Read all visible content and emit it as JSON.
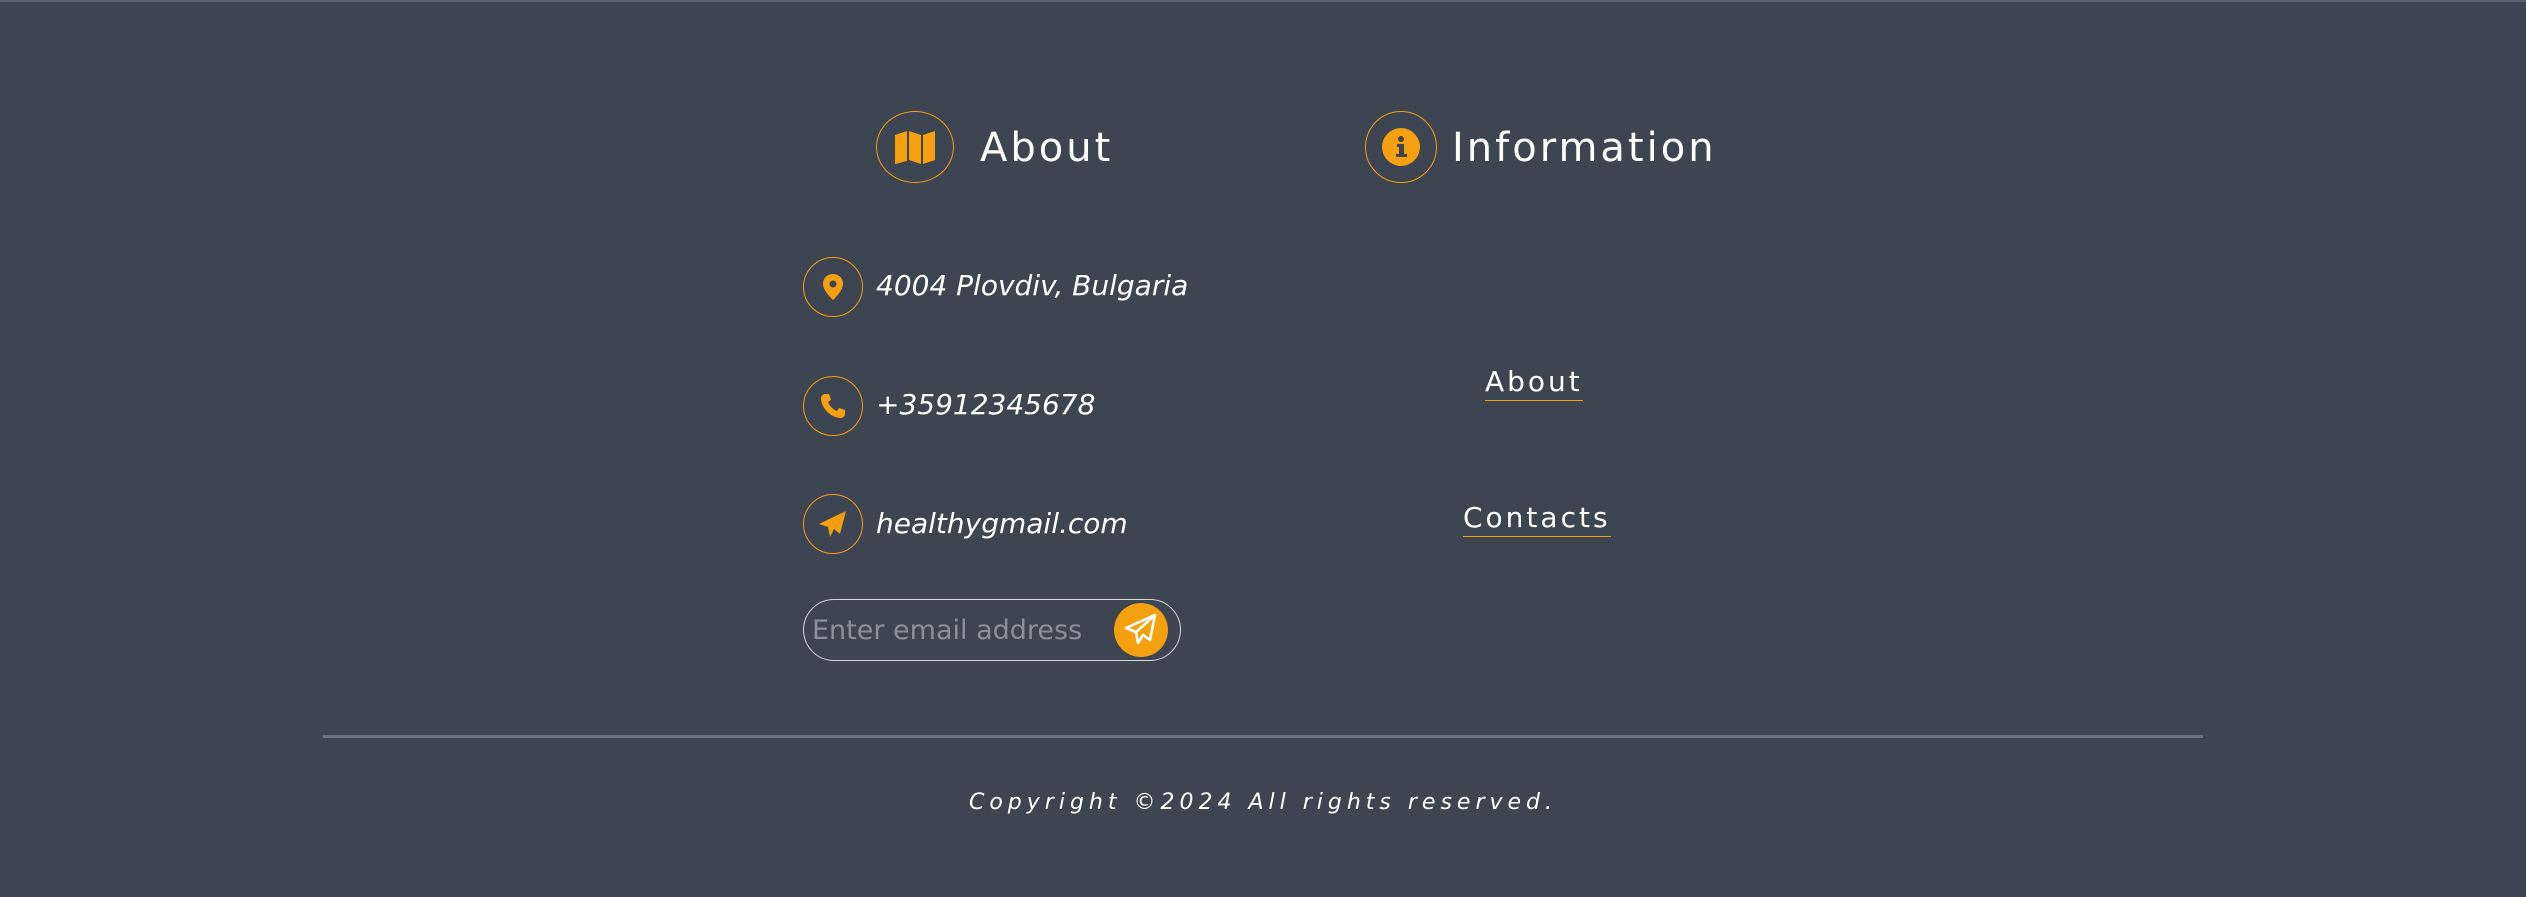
{
  "footer": {
    "about_heading": "About",
    "information_heading": "Information",
    "contacts": {
      "address": "4004 Plovdiv, Bulgaria",
      "phone": "+35912345678",
      "email": "healthygmail.com"
    },
    "subscribe": {
      "placeholder": "Enter email address"
    },
    "links": {
      "about": "About",
      "contacts": "Contacts"
    },
    "copyright": "Copyright ©2024 All rights reserved."
  },
  "colors": {
    "background": "#3d4452",
    "accent": "#f5a00f",
    "text": "#ffffff",
    "divider": "#6c7280"
  },
  "icons": {
    "about": "map-icon",
    "information": "info-icon",
    "address": "location-pin-icon",
    "phone": "phone-icon",
    "email": "paper-plane-icon",
    "send": "paper-plane-icon"
  }
}
